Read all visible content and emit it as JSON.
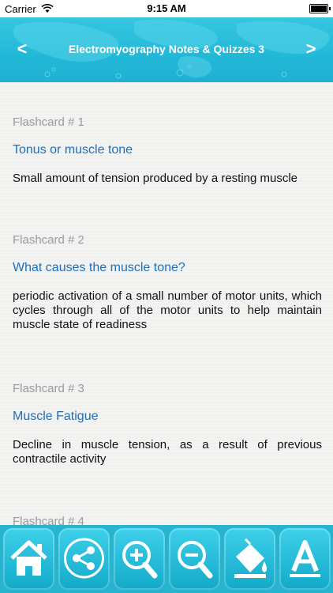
{
  "status_bar": {
    "carrier": "Carrier",
    "time": "9:15 AM",
    "battery_level": 1.0
  },
  "header": {
    "title": "Electromyography Notes & Quizzes 3",
    "prev_label": "<",
    "next_label": ">"
  },
  "cards": [
    {
      "label": "Flashcard # 1",
      "question": "Tonus or muscle tone",
      "answer": "Small amount of tension produced by a resting muscle"
    },
    {
      "label": "Flashcard # 2",
      "question": "What causes the muscle tone?",
      "answer": "periodic activation of a small number of motor units, which cycles through all of the motor units to help maintain muscle state of readiness"
    },
    {
      "label": "Flashcard # 3",
      "question": "Muscle Fatigue",
      "answer": "Decline in muscle tension, as a result of previous contractile activity"
    },
    {
      "label": "Flashcard # 4"
    }
  ],
  "toolbar": {
    "buttons": [
      {
        "icon": "home-icon"
      },
      {
        "icon": "share-icon"
      },
      {
        "icon": "zoom-in-icon"
      },
      {
        "icon": "zoom-out-icon"
      },
      {
        "icon": "paint-bucket-icon"
      },
      {
        "icon": "font-icon"
      }
    ]
  },
  "colors": {
    "header": "#22b8d8",
    "question_text": "#1f6fb8",
    "label_text": "#9a9a9a",
    "toolbar": "#27b4cf"
  }
}
